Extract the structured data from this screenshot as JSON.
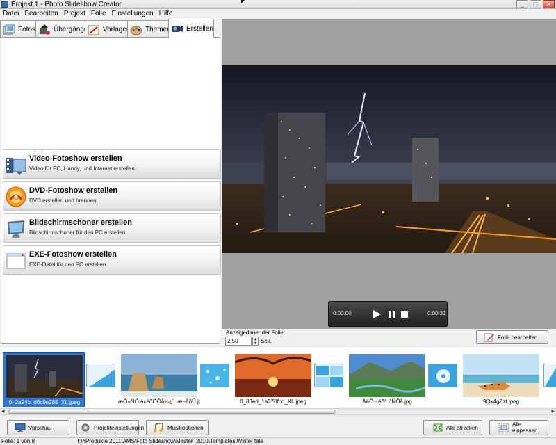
{
  "window": {
    "title": "Projekt 1 - Photo Slideshow Creator",
    "buttons": [
      "_",
      "□",
      "✕"
    ]
  },
  "menu": {
    "items": [
      "Datei",
      "Bearbeiten",
      "Projekt",
      "Folie",
      "Einstellungen",
      "Hilfe"
    ]
  },
  "tabs": [
    "Fotos",
    "Übergänge",
    "Vorlagen",
    "Themen",
    "Erstellen"
  ],
  "active_tab": "Erstellen",
  "actions": [
    {
      "title": "Video-Fotoshow erstellen",
      "subtitle": "Video für PC, Handy, und Internet erstellen"
    },
    {
      "title": "DVD-Fotoshow erstellen",
      "subtitle": "DVD erstellen und brennen"
    },
    {
      "title": "Bildschirmschoner erstellen",
      "subtitle": "Bildschirmschoner für den PC erstellen"
    },
    {
      "title": "EXE-Fotoshow erstellen",
      "subtitle": "EXE-Datei für den PC erstellen"
    }
  ],
  "player": {
    "current_time": "0:00:00",
    "total_time": "0:00:32"
  },
  "slide_duration": {
    "label": "Anzeigedauer der Folie:",
    "value": "2,50",
    "unit": "Sek."
  },
  "edit_slide_button": "Folie bearbeiten",
  "slides": [
    {
      "caption": "0_2a94b_d6c0e285_XL.jpeg",
      "selected": true
    },
    {
      "caption": "æÒ»ÑÖ ácëðÖÓå¼¿´ ·æ~åñÜ.jpeg",
      "selected": false
    },
    {
      "caption": "0_88ed_1a370fcd_XL.jpeg",
      "selected": false
    },
    {
      "caption": "ÀäÖ~ éõ^ ùÑÖå.jpg",
      "selected": false
    },
    {
      "caption": "9Qx4gZzt.jpeg",
      "selected": false
    }
  ],
  "bottom_buttons": {
    "preview": "Vorschau",
    "project_settings": "Projekteinstellungen",
    "music_options": "Musikoptionen",
    "stretch_all": "Alle strecken",
    "fit_all": "Alle einpassen"
  },
  "status": {
    "slide_counter": "Folie: 1 von 8",
    "path": "T:\\#Produkte 2011\\AMS\\Foto Slideshow\\Master_2010\\Templates\\Winter tale"
  },
  "colors": {
    "selection": "#3476cc",
    "preview_bg": "#a0a0a0",
    "panel_bg": "#f0f0f0"
  }
}
